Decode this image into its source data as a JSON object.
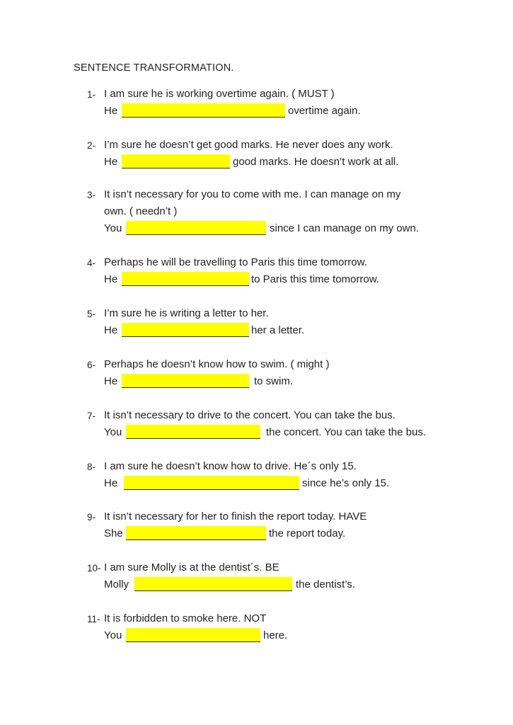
{
  "title": "SENTENCE  TRANSFORMATION.",
  "highlight_color": "#ffff00",
  "items": [
    {
      "num": "1-",
      "lines": [
        "I am sure he is working overtime again.  ( MUST )"
      ],
      "subject": "He",
      "after": "overtime again."
    },
    {
      "num": "2-",
      "lines": [
        "I’m sure he doesn’t get good marks. He never does any work."
      ],
      "subject": "He",
      "after": "good marks. He doesn’t work at all."
    },
    {
      "num": "3-",
      "lines": [
        "It isn’t necessary for you to come with me. I can manage on my",
        "own.  ( needn’t )"
      ],
      "subject": "You",
      "after": "since I can manage on my own."
    },
    {
      "num": "4-",
      "lines": [
        "Perhaps he will be travelling to Paris this time tomorrow."
      ],
      "subject": "He",
      "after": "to Paris this time tomorrow."
    },
    {
      "num": "5-",
      "lines": [
        "I’m sure he is writing a letter to her."
      ],
      "subject": "He",
      "after": "her a letter."
    },
    {
      "num": "6-",
      "lines": [
        "Perhaps he doesn’t know how to swim.  ( might )"
      ],
      "subject": "He",
      "after": "to swim."
    },
    {
      "num": "7-",
      "lines": [
        "It isn’t necessary to drive to the concert. You can take the bus."
      ],
      "subject": "You",
      "after": "the concert. You can take the bus."
    },
    {
      "num": "8-",
      "lines": [
        "I am sure he doesn’t know how to drive. He´s only 15."
      ],
      "subject": "He",
      "after": "since he’s only 15."
    },
    {
      "num": "9-",
      "lines": [
        "It isn’t necessary for her to finish the report today. HAVE"
      ],
      "subject": "She",
      "after": "the report today."
    },
    {
      "num": "10-",
      "lines": [
        "I am sure Molly is at the dentist´s. BE"
      ],
      "subject": "Molly",
      "after": "the dentist’s."
    },
    {
      "num": "11-",
      "lines": [
        "It is forbidden to smoke here. NOT"
      ],
      "subject": "You",
      "after": "here."
    }
  ]
}
